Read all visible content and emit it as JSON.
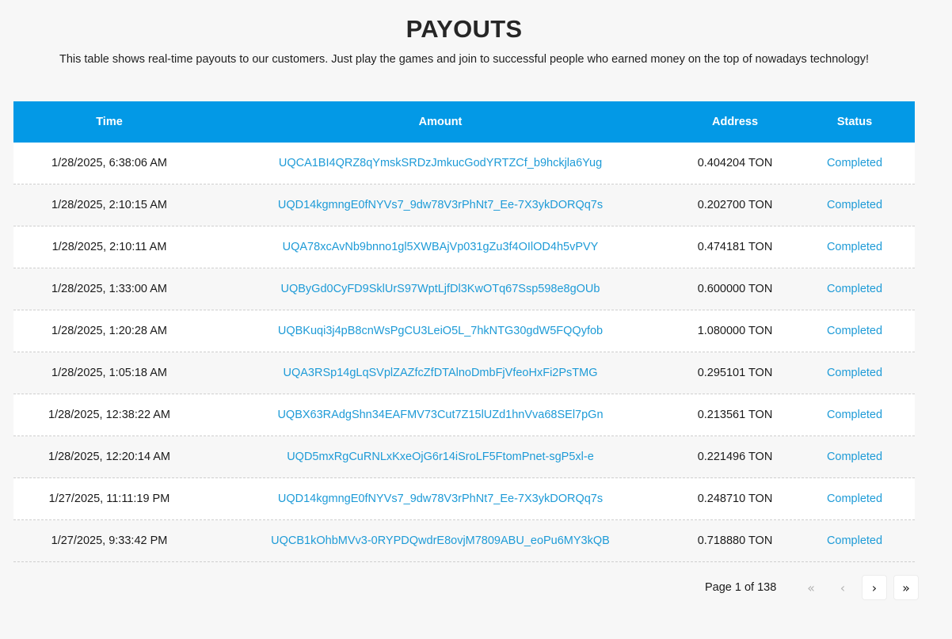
{
  "header": {
    "title": "PAYOUTS",
    "subtitle": "This table shows real-time payouts to our customers. Just play the games and join to successful people who earned money on the top of nowadays technology!"
  },
  "table": {
    "columns": [
      "Time",
      "Amount",
      "Address",
      "Status"
    ],
    "rows": [
      {
        "time": "1/28/2025, 6:38:06 AM",
        "amount": "UQCA1BI4QRZ8qYmskSRDzJmkucGodYRTZCf_b9hckjla6Yug",
        "address": "0.404204 TON",
        "status": "Completed"
      },
      {
        "time": "1/28/2025, 2:10:15 AM",
        "amount": "UQD14kgmngE0fNYVs7_9dw78V3rPhNt7_Ee-7X3ykDORQq7s",
        "address": "0.202700 TON",
        "status": "Completed"
      },
      {
        "time": "1/28/2025, 2:10:11 AM",
        "amount": "UQA78xcAvNb9bnno1gl5XWBAjVp031gZu3f4OIlOD4h5vPVY",
        "address": "0.474181 TON",
        "status": "Completed"
      },
      {
        "time": "1/28/2025, 1:33:00 AM",
        "amount": "UQByGd0CyFD9SklUrS97WptLjfDl3KwOTq67Ssp598e8gOUb",
        "address": "0.600000 TON",
        "status": "Completed"
      },
      {
        "time": "1/28/2025, 1:20:28 AM",
        "amount": "UQBKuqi3j4pB8cnWsPgCU3LeiO5L_7hkNTG30gdW5FQQyfob",
        "address": "1.080000 TON",
        "status": "Completed"
      },
      {
        "time": "1/28/2025, 1:05:18 AM",
        "amount": "UQA3RSp14gLqSVplZAZfcZfDTAlnoDmbFjVfeoHxFi2PsTMG",
        "address": "0.295101 TON",
        "status": "Completed"
      },
      {
        "time": "1/28/2025, 12:38:22 AM",
        "amount": "UQBX63RAdgShn34EAFMV73Cut7Z15lUZd1hnVva68SEl7pGn",
        "address": "0.213561 TON",
        "status": "Completed"
      },
      {
        "time": "1/28/2025, 12:20:14 AM",
        "amount": "UQD5mxRgCuRNLxKxeOjG6r14iSroLF5FtomPnet-sgP5xl-e",
        "address": "0.221496 TON",
        "status": "Completed"
      },
      {
        "time": "1/27/2025, 11:11:19 PM",
        "amount": "UQD14kgmngE0fNYVs7_9dw78V3rPhNt7_Ee-7X3ykDORQq7s",
        "address": "0.248710 TON",
        "status": "Completed"
      },
      {
        "time": "1/27/2025, 9:33:42 PM",
        "amount": "UQCB1kOhbMVv3-0RYPDQwdrE8ovjM7809ABU_eoPu6MY3kQB",
        "address": "0.718880 TON",
        "status": "Completed"
      }
    ]
  },
  "pagination": {
    "label": "Page 1 of 138",
    "first_icon": "«",
    "prev_icon": "‹",
    "next_icon": "›",
    "last_icon": "»"
  },
  "colors": {
    "header_bg": "#0399e6",
    "link": "#1e9bd7",
    "page_bg": "#f7f7f7"
  }
}
